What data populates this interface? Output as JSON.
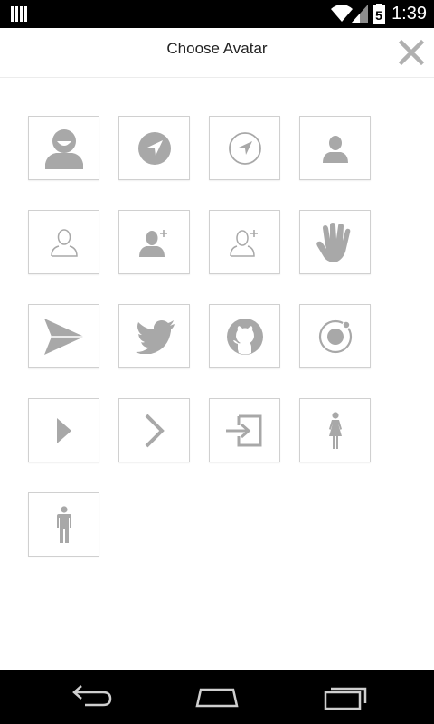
{
  "status_bar": {
    "time": "1:39",
    "battery_level": "5",
    "icons": [
      "notification-bars-icon",
      "wifi-icon",
      "signal-icon",
      "battery-icon"
    ]
  },
  "header": {
    "title": "Choose Avatar",
    "close_icon": "close-icon"
  },
  "avatars": [
    {
      "icon": "person-smile-icon"
    },
    {
      "icon": "navigate-filled-icon"
    },
    {
      "icon": "navigate-outline-icon"
    },
    {
      "icon": "person-icon"
    },
    {
      "icon": "person-outline-icon"
    },
    {
      "icon": "person-add-icon"
    },
    {
      "icon": "person-add-outline-icon"
    },
    {
      "icon": "hand-icon"
    },
    {
      "icon": "paper-airplane-icon"
    },
    {
      "icon": "twitter-bird-icon"
    },
    {
      "icon": "github-icon"
    },
    {
      "icon": "ionic-icon"
    },
    {
      "icon": "play-icon"
    },
    {
      "icon": "chevron-right-icon"
    },
    {
      "icon": "log-in-icon"
    },
    {
      "icon": "female-icon"
    },
    {
      "icon": "male-icon"
    }
  ],
  "nav_bar": {
    "buttons": [
      "back-icon",
      "home-icon",
      "recent-apps-icon"
    ]
  },
  "colors": {
    "icon_gray": "#a8a8a8",
    "tile_border": "#d0d0d0",
    "header_text": "#222222",
    "close_gray": "#b0b0b0"
  }
}
